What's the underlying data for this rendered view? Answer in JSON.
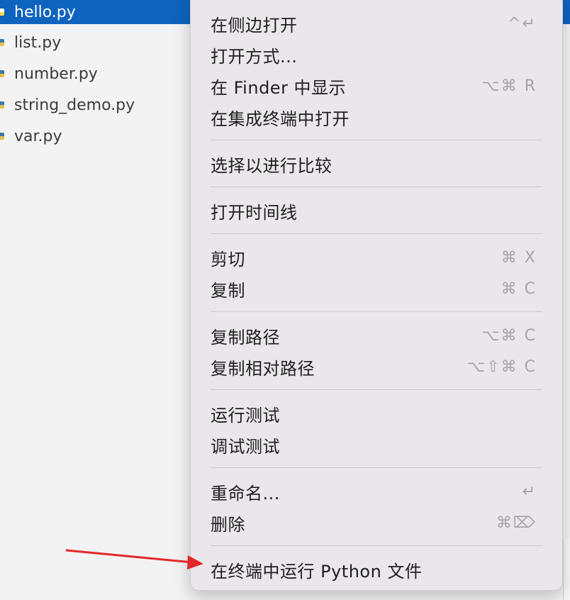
{
  "explorer": {
    "files": [
      {
        "name": "hello.py",
        "selected": true
      },
      {
        "name": "list.py",
        "selected": false
      },
      {
        "name": "number.py",
        "selected": false
      },
      {
        "name": "string_demo.py",
        "selected": false
      },
      {
        "name": "var.py",
        "selected": false
      }
    ]
  },
  "context_menu": {
    "items": [
      {
        "label": "在侧边打开",
        "shortcut": "^↵"
      },
      {
        "label": "打开方式...",
        "shortcut": ""
      },
      {
        "label": "在 Finder 中显示",
        "shortcut": "⌥⌘ R"
      },
      {
        "label": "在集成终端中打开",
        "shortcut": ""
      },
      {
        "label": "选择以进行比较",
        "shortcut": ""
      },
      {
        "label": "打开时间线",
        "shortcut": ""
      },
      {
        "label": "剪切",
        "shortcut": "⌘ X"
      },
      {
        "label": "复制",
        "shortcut": "⌘ C"
      },
      {
        "label": "复制路径",
        "shortcut": "⌥⌘ C"
      },
      {
        "label": "复制相对路径",
        "shortcut": "⌥⇧⌘ C"
      },
      {
        "label": "运行测试",
        "shortcut": ""
      },
      {
        "label": "调试测试",
        "shortcut": ""
      },
      {
        "label": "重命名...",
        "shortcut": "↵"
      },
      {
        "label": "删除",
        "shortcut": "⌘⌦"
      },
      {
        "label": "在终端中运行 Python 文件",
        "shortcut": ""
      }
    ]
  },
  "colors": {
    "selection": "#0e63be",
    "menu_background": "#ebe6ec",
    "annotation_arrow": "#e3262b"
  }
}
